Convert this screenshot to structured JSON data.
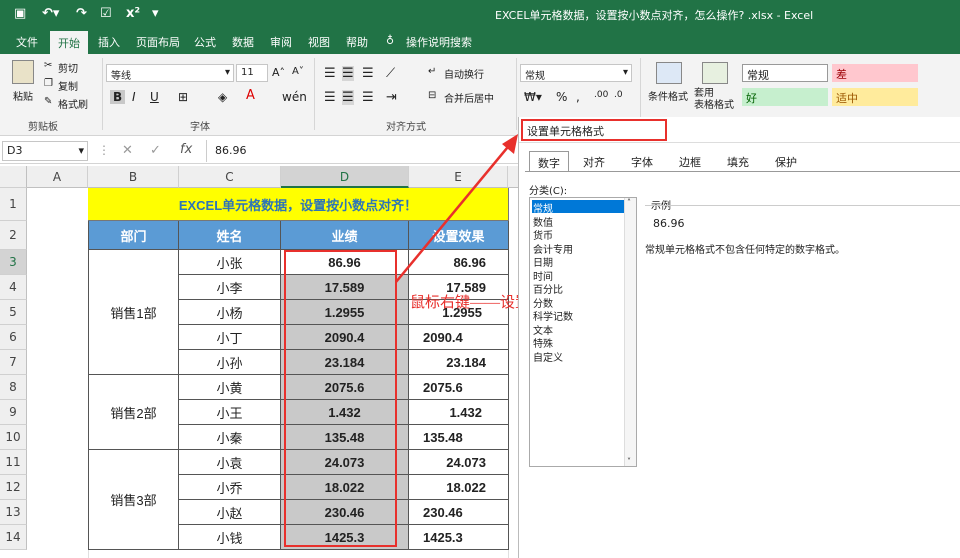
{
  "window": {
    "title": "EXCEL单元格数据，设置按小数点对齐，怎么操作? .xlsx - Excel"
  },
  "ribbon_tabs": [
    "文件",
    "开始",
    "插入",
    "页面布局",
    "公式",
    "数据",
    "审阅",
    "视图",
    "帮助",
    "操作说明搜索"
  ],
  "ribbon": {
    "cut": "剪切",
    "copy": "复制",
    "format_painter": "格式刷",
    "paste": "粘贴",
    "clipboard_group": "剪贴板",
    "font_name": "等线",
    "font_size": "11",
    "font_group": "字体",
    "wrap_text": "自动换行",
    "merge_center": "合并后居中",
    "alignment_group": "对齐方式",
    "number_format": "常规",
    "conditional_format": "条件格式",
    "table_format": "套用\n表格格式",
    "style_normal": "常规",
    "style_bad": "差",
    "style_good": "好",
    "style_neutral": "适中"
  },
  "formula_bar": {
    "name_box": "D3",
    "fx": "fx",
    "value": "86.96"
  },
  "sheet": {
    "columns": [
      "A",
      "B",
      "C",
      "D",
      "E"
    ],
    "rows": [
      "1",
      "2",
      "3",
      "4",
      "5",
      "6",
      "7",
      "8",
      "9",
      "10",
      "11",
      "12",
      "13",
      "14"
    ],
    "banner": "EXCEL单元格数据，设置按小数点对齐！",
    "headers": [
      "部门",
      "姓名",
      "业绩",
      "设置效果"
    ],
    "groups": [
      "销售1部",
      "销售2部",
      "销售3部"
    ],
    "names": [
      "小张",
      "小李",
      "小杨",
      "小丁",
      "小孙",
      "小黄",
      "小王",
      "小秦",
      "小袁",
      "小乔",
      "小赵",
      "小钱"
    ],
    "values": [
      "86.96",
      "17.589",
      "1.2955",
      "2090.4",
      "23.184",
      "2075.6",
      "1.432",
      "135.48",
      "24.073",
      "18.022",
      "230.46",
      "1425.3"
    ],
    "effect": [
      "86.96",
      "17.589",
      "1.2955",
      "2090.4",
      "23.184",
      "2075.6",
      "1.432",
      "135.48",
      "24.073",
      "18.022",
      "230.46",
      "1425.3"
    ],
    "annotation": "鼠标右键——设置单元格格式"
  },
  "dialog": {
    "title": "设置单元格格式",
    "tabs": [
      "数字",
      "对齐",
      "字体",
      "边框",
      "填充",
      "保护"
    ],
    "category_label": "分类(C):",
    "categories": [
      "常规",
      "数值",
      "货币",
      "会计专用",
      "日期",
      "时间",
      "百分比",
      "分数",
      "科学记数",
      "文本",
      "特殊",
      "自定义"
    ],
    "sample_label": "示例",
    "sample_value": "86.96",
    "description": "常规单元格格式不包含任何特定的数字格式。"
  },
  "colors": {
    "excel_green": "#217346",
    "header_blue": "#5b9bd5",
    "banner_yellow": "#ffff00",
    "annotation_red": "#e8302c"
  }
}
